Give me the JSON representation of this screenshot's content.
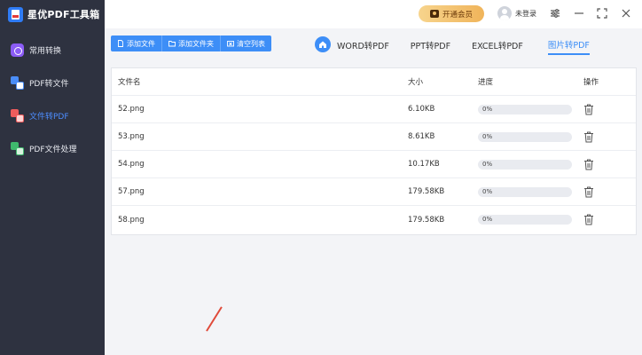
{
  "app": {
    "title": "星优PDF工具箱"
  },
  "sidebar": {
    "items": [
      {
        "label": "常用转换",
        "icon": "convert-icon",
        "active": false
      },
      {
        "label": "PDF转文件",
        "icon": "pdf-to-file-icon",
        "active": false
      },
      {
        "label": "文件转PDF",
        "icon": "file-to-pdf-icon",
        "active": true
      },
      {
        "label": "PDF文件处理",
        "icon": "pdf-process-icon",
        "active": false
      }
    ]
  },
  "topbar": {
    "vip_label": "开通会员",
    "user_label": "未登录"
  },
  "toolbar": {
    "add_file": "添加文件",
    "add_folder": "添加文件夹",
    "clear_list": "清空列表"
  },
  "tabs": [
    {
      "label": "WORD转PDF",
      "active": false
    },
    {
      "label": "PPT转PDF",
      "active": false
    },
    {
      "label": "EXCEL转PDF",
      "active": false
    },
    {
      "label": "图片转PDF",
      "active": true
    }
  ],
  "table": {
    "headers": {
      "name": "文件名",
      "size": "大小",
      "progress": "进度",
      "action": "操作"
    },
    "rows": [
      {
        "name": "52.png",
        "size": "6.10KB",
        "progress": "0%",
        "progress_value": 0
      },
      {
        "name": "53.png",
        "size": "8.61KB",
        "progress": "0%",
        "progress_value": 0
      },
      {
        "name": "54.png",
        "size": "10.17KB",
        "progress": "0%",
        "progress_value": 0
      },
      {
        "name": "57.png",
        "size": "179.58KB",
        "progress": "0%",
        "progress_value": 0
      },
      {
        "name": "58.png",
        "size": "179.58KB",
        "progress": "0%",
        "progress_value": 0
      }
    ]
  },
  "colors": {
    "accent": "#3d8ef7",
    "sidebar_bg": "#2e3240",
    "vip_gold": "#f0b45a"
  }
}
